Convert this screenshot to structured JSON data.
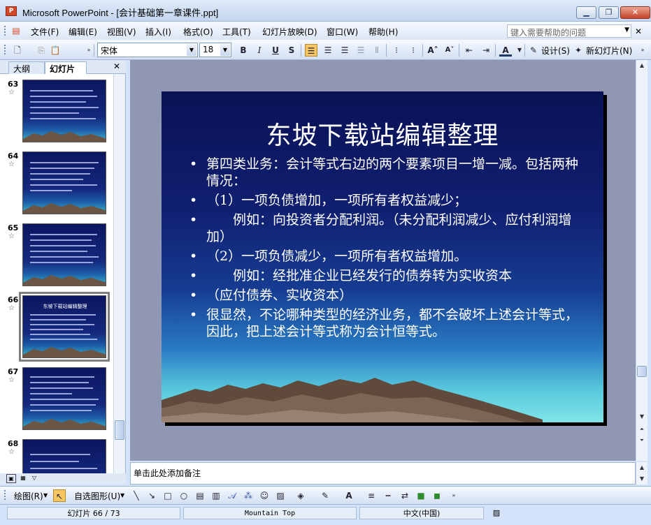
{
  "window": {
    "title": "Microsoft PowerPoint - [会计基础第一章课件.ppt]",
    "app_icon": "P",
    "controls": [
      "minimize-icon",
      "restore-icon",
      "close-icon"
    ]
  },
  "menu": {
    "items": [
      "文件(F)",
      "编辑(E)",
      "视图(V)",
      "插入(I)",
      "格式(O)",
      "工具(T)",
      "幻灯片放映(D)",
      "窗口(W)",
      "帮助(H)"
    ],
    "help_placeholder": "键入需要帮助的问题"
  },
  "toolbar": {
    "font_name": "宋体",
    "font_size": "18",
    "bold": "B",
    "italic": "I",
    "underline": "U",
    "shadow": "S",
    "font_color_label": "A",
    "design_label": "设计(S)",
    "new_slide_label": "新幻灯片(N)"
  },
  "left_pane": {
    "tabs": [
      "大纲",
      "幻灯片"
    ],
    "active_tab": "幻灯片",
    "slides": [
      {
        "number": "63",
        "selected": false
      },
      {
        "number": "64",
        "selected": false
      },
      {
        "number": "65",
        "selected": false
      },
      {
        "number": "66",
        "selected": true,
        "title": "东坡下载站编辑整理"
      },
      {
        "number": "67",
        "selected": false
      },
      {
        "number": "68",
        "selected": false
      }
    ]
  },
  "slide": {
    "title": "东坡下载站编辑整理",
    "bullets": [
      "第四类业务：会计等式右边的两个要素项目一增一减。包括两种情况：",
      "（1）一项负债增加，一项所有者权益减少；",
      "　　例如：向投资者分配利润。（未分配利润减少、应付利润增加）",
      "（2）一项负债减少，一项所有者权益增加。",
      "　　例如：经批准企业已经发行的债券转为实收资本",
      "（应付债券、实收资本）",
      "很显然，不论哪种类型的经济业务，都不会破坏上述会计等式，因此，把上述会计等式称为会计恒等式。"
    ]
  },
  "notes": {
    "placeholder": "单击此处添加备注"
  },
  "drawbar": {
    "draw_label": "绘图(R)",
    "autoshapes_label": "自选图形(U)"
  },
  "status": {
    "slide_position": "幻灯片 66 / 73",
    "design": "Mountain Top",
    "language": "中文(中国)"
  },
  "colors": {
    "slide_top": "#0a1255",
    "slide_bottom": "#7fe5e8",
    "highlight": "#f8c563"
  }
}
